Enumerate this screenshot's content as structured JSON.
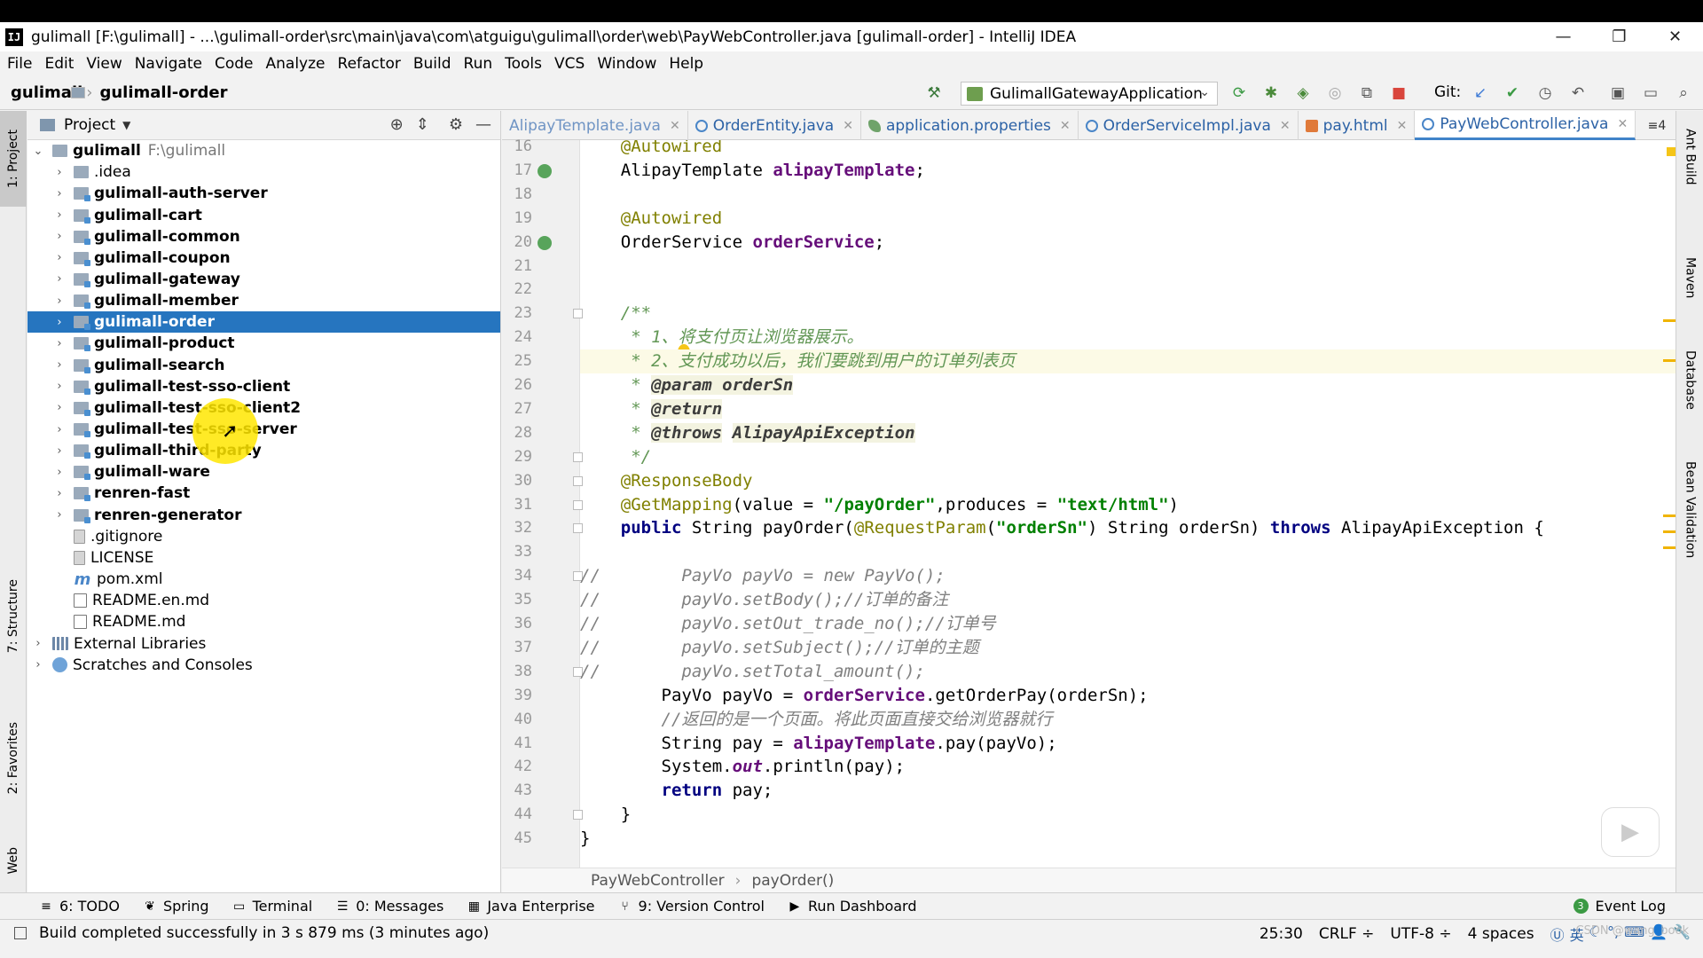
{
  "window": {
    "title": "gulimall [F:\\gulimall] - ...\\gulimall-order\\src\\main\\java\\com\\atguigu\\gulimall\\order\\web\\PayWebController.java [gulimall-order] - IntelliJ IDEA",
    "logo": "IJ"
  },
  "menu": [
    "File",
    "Edit",
    "View",
    "Navigate",
    "Code",
    "Analyze",
    "Refactor",
    "Build",
    "Run",
    "Tools",
    "VCS",
    "Window",
    "Help"
  ],
  "nav": {
    "root": "gulimall",
    "module": "gulimall-order"
  },
  "run_config": "GulimallGatewayApplication",
  "git_label": "Git:",
  "left_tabs": [
    "1: Project",
    "7: Structure",
    "2: Favorites",
    "Web"
  ],
  "right_tabs": [
    "Ant Build",
    "Maven",
    "Database",
    "Bean Validation"
  ],
  "project": {
    "title": "Project",
    "tree": [
      {
        "label": "gulimall",
        "path": "F:\\gulimall",
        "indent": 0,
        "arrow": "open",
        "bold": true,
        "icon": "folder"
      },
      {
        "label": ".idea",
        "indent": 1,
        "arrow": "closed",
        "bold": false,
        "icon": "folder"
      },
      {
        "label": "gulimall-auth-server",
        "indent": 1,
        "arrow": "closed",
        "bold": true,
        "icon": "module"
      },
      {
        "label": "gulimall-cart",
        "indent": 1,
        "arrow": "closed",
        "bold": true,
        "icon": "module"
      },
      {
        "label": "gulimall-common",
        "indent": 1,
        "arrow": "closed",
        "bold": true,
        "icon": "module"
      },
      {
        "label": "gulimall-coupon",
        "indent": 1,
        "arrow": "closed",
        "bold": true,
        "icon": "module"
      },
      {
        "label": "gulimall-gateway",
        "indent": 1,
        "arrow": "closed",
        "bold": true,
        "icon": "module"
      },
      {
        "label": "gulimall-member",
        "indent": 1,
        "arrow": "closed",
        "bold": true,
        "icon": "module"
      },
      {
        "label": "gulimall-order",
        "indent": 1,
        "arrow": "closed",
        "bold": true,
        "icon": "module",
        "selected": true
      },
      {
        "label": "gulimall-product",
        "indent": 1,
        "arrow": "closed",
        "bold": true,
        "icon": "module"
      },
      {
        "label": "gulimall-search",
        "indent": 1,
        "arrow": "closed",
        "bold": true,
        "icon": "module"
      },
      {
        "label": "gulimall-test-sso-client",
        "indent": 1,
        "arrow": "closed",
        "bold": true,
        "icon": "module"
      },
      {
        "label": "gulimall-test-sso-client2",
        "indent": 1,
        "arrow": "closed",
        "bold": true,
        "icon": "module"
      },
      {
        "label": "gulimall-test-sso-server",
        "indent": 1,
        "arrow": "closed",
        "bold": true,
        "icon": "module"
      },
      {
        "label": "gulimall-third-party",
        "indent": 1,
        "arrow": "closed",
        "bold": true,
        "icon": "module"
      },
      {
        "label": "gulimall-ware",
        "indent": 1,
        "arrow": "closed",
        "bold": true,
        "icon": "module"
      },
      {
        "label": "renren-fast",
        "indent": 1,
        "arrow": "closed",
        "bold": true,
        "icon": "module"
      },
      {
        "label": "renren-generator",
        "indent": 1,
        "arrow": "closed",
        "bold": true,
        "icon": "module"
      },
      {
        "label": ".gitignore",
        "indent": 1,
        "arrow": "none",
        "bold": false,
        "icon": "file"
      },
      {
        "label": "LICENSE",
        "indent": 1,
        "arrow": "none",
        "bold": false,
        "icon": "file"
      },
      {
        "label": "pom.xml",
        "indent": 1,
        "arrow": "none",
        "bold": false,
        "icon": "pom"
      },
      {
        "label": "README.en.md",
        "indent": 1,
        "arrow": "none",
        "bold": false,
        "icon": "md"
      },
      {
        "label": "README.md",
        "indent": 1,
        "arrow": "none",
        "bold": false,
        "icon": "md"
      },
      {
        "label": "External Libraries",
        "indent": 0,
        "arrow": "closed",
        "bold": false,
        "icon": "lib"
      },
      {
        "label": "Scratches and Consoles",
        "indent": 0,
        "arrow": "closed",
        "bold": false,
        "icon": "scratch"
      }
    ]
  },
  "tabs": [
    {
      "label": "AlipayTemplate.java",
      "icon": "class",
      "faded": true
    },
    {
      "label": "OrderEntity.java",
      "icon": "class"
    },
    {
      "label": "application.properties",
      "icon": "leaf"
    },
    {
      "label": "OrderServiceImpl.java",
      "icon": "class"
    },
    {
      "label": "pay.html",
      "icon": "html"
    },
    {
      "label": "PayWebController.java",
      "icon": "class",
      "active": true
    }
  ],
  "tab_more": "≡4",
  "code_lines": [
    {
      "n": "16",
      "html": "    <span class=\"ann\">@Autowired</span>"
    },
    {
      "n": "17",
      "html": "    AlipayTemplate <span class=\"fld\">alipayTemplate</span>;"
    },
    {
      "n": "18",
      "html": ""
    },
    {
      "n": "19",
      "html": "    <span class=\"ann\">@Autowired</span>"
    },
    {
      "n": "20",
      "html": "    OrderService <span class=\"fld\">orderService</span>;"
    },
    {
      "n": "21",
      "html": ""
    },
    {
      "n": "22",
      "html": ""
    },
    {
      "n": "23",
      "html": "    <span class=\"doc\">/**</span>"
    },
    {
      "n": "24",
      "html": "<span class=\"doc\">     * 1、将支付页让浏览器展示。</span>"
    },
    {
      "n": "25",
      "html": "<span class=\"doc\">     * 2、支付成功以后，我们要跳到用户的订单列表页</span>"
    },
    {
      "n": "26",
      "html": "<span class=\"doc\">     * </span><span class=\"doctag\">@param orderSn</span>"
    },
    {
      "n": "27",
      "html": "<span class=\"doc\">     * </span><span class=\"doctag\">@return</span>"
    },
    {
      "n": "28",
      "html": "<span class=\"doc\">     * </span><span class=\"doctag\">@throws</span> <span class=\"doctag\">AlipayApiException</span>"
    },
    {
      "n": "29",
      "html": "<span class=\"doc\">     */</span>"
    },
    {
      "n": "30",
      "html": "    <span class=\"ann\">@ResponseBody</span>"
    },
    {
      "n": "31",
      "html": "    <span class=\"ann\">@GetMapping</span>(value = <span class=\"str\">\"/payOrder\"</span>,produces = <span class=\"str\">\"text/html\"</span>)"
    },
    {
      "n": "32",
      "html": "    <span class=\"kw\">public</span> String payOrder(<span class=\"ann\">@RequestParam</span>(<span class=\"str\">\"orderSn\"</span>) String orderSn) <span class=\"kw\">throws</span> AlipayApiException {"
    },
    {
      "n": "33",
      "html": ""
    },
    {
      "n": "34",
      "html": "<span class=\"com\">//        PayVo payVo = new PayVo();</span>"
    },
    {
      "n": "35",
      "html": "<span class=\"com\">//        payVo.setBody();//订单的备注</span>"
    },
    {
      "n": "36",
      "html": "<span class=\"com\">//        payVo.setOut_trade_no();//订单号</span>"
    },
    {
      "n": "37",
      "html": "<span class=\"com\">//        payVo.setSubject();//订单的主题</span>"
    },
    {
      "n": "38",
      "html": "<span class=\"com\">//        payVo.setTotal_amount();</span>"
    },
    {
      "n": "39",
      "html": "        PayVo payVo = <span class=\"fld\">orderService</span>.getOrderPay(orderSn);"
    },
    {
      "n": "40",
      "html": "        <span class=\"com\">//返回的是一个页面。将此页面直接交给浏览器就行</span>"
    },
    {
      "n": "41",
      "html": "        String pay = <span class=\"fld\">alipayTemplate</span>.pay(payVo);"
    },
    {
      "n": "42",
      "html": "        System.<span class=\"stat\">out</span>.println(pay);"
    },
    {
      "n": "43",
      "html": "        <span class=\"kw\">return</span> pay;"
    },
    {
      "n": "44",
      "html": "    }"
    },
    {
      "n": "45",
      "html": "}"
    }
  ],
  "editor_crumb": {
    "class_name": "PayWebController",
    "method": "payOrder()"
  },
  "bottom_tools": [
    {
      "label": "6: TODO",
      "icon": "≡"
    },
    {
      "label": "Spring",
      "icon": "❦"
    },
    {
      "label": "Terminal",
      "icon": "▭"
    },
    {
      "label": "0: Messages",
      "icon": "☰"
    },
    {
      "label": "Java Enterprise",
      "icon": "▦"
    },
    {
      "label": "9: Version Control",
      "icon": "⑂"
    },
    {
      "label": "Run Dashboard",
      "icon": "▶"
    }
  ],
  "event_log": {
    "label": "Event Log",
    "count": "3"
  },
  "status": {
    "message": "Build completed successfully in 3 s 879 ms (3 minutes ago)",
    "position": "25:30",
    "line_sep": "CRLF ÷",
    "encoding": "UTF-8 ÷",
    "indent": "4 spaces",
    "ime": "英"
  },
  "credit": "CSDN @wang_book"
}
